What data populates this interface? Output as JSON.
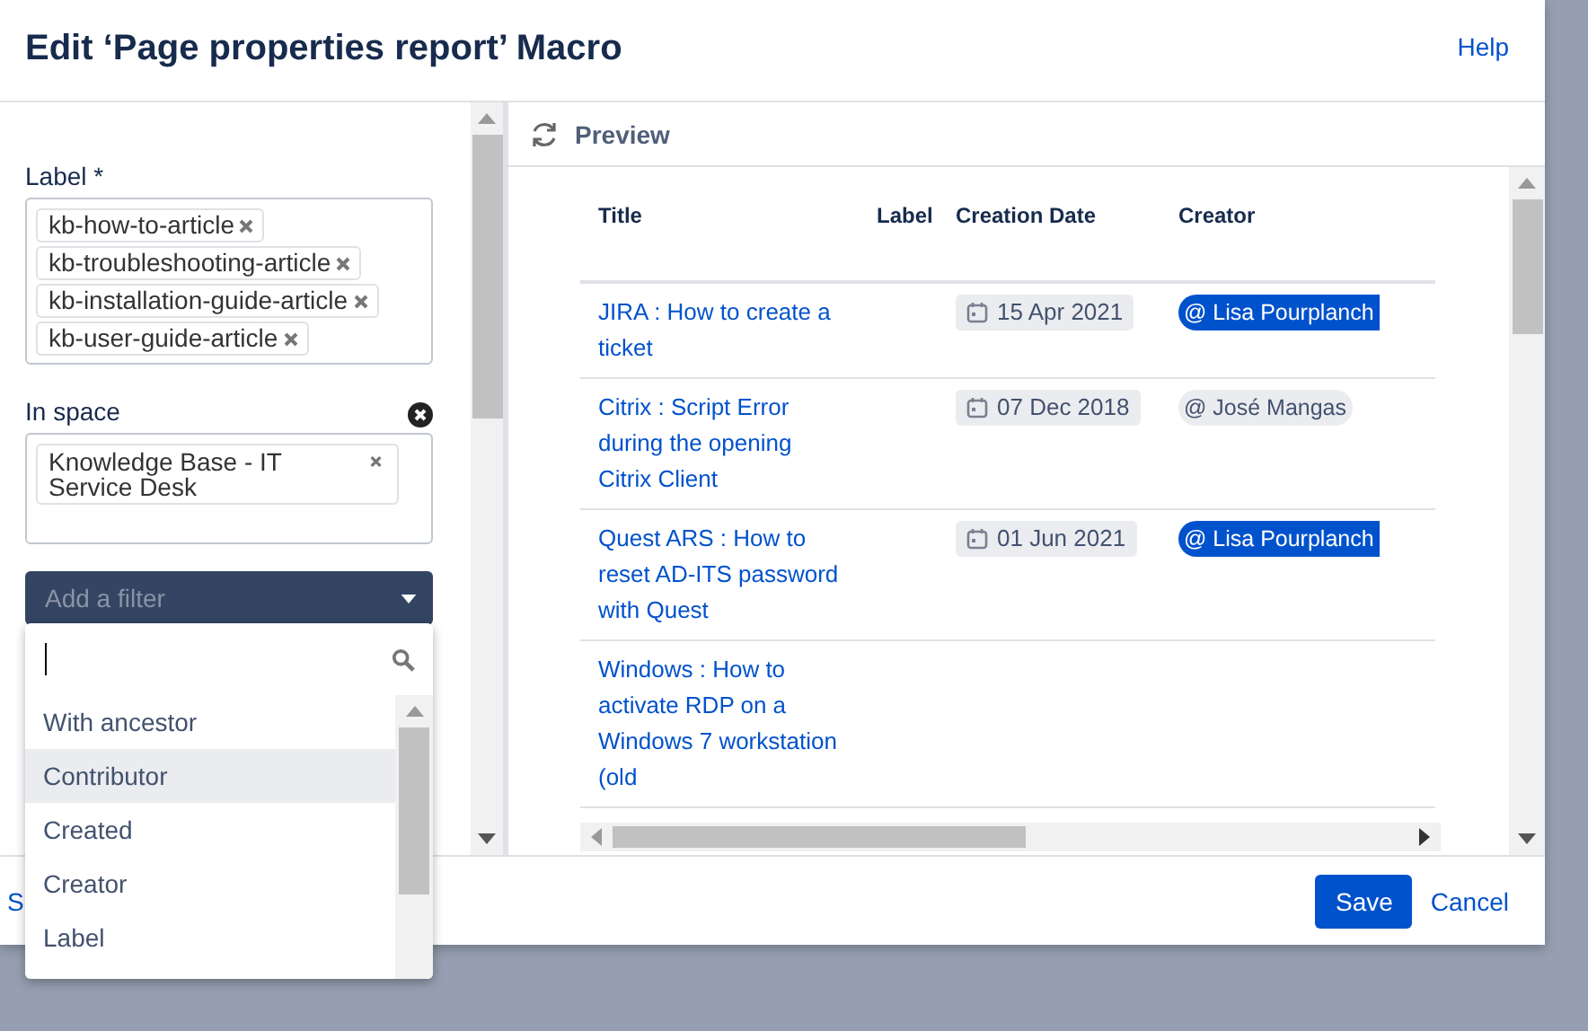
{
  "dialog": {
    "title": "Edit ‘Page properties report’ Macro",
    "help": "Help"
  },
  "form": {
    "label_field": {
      "label": "Label *",
      "tags": [
        "kb-how-to-article",
        "kb-troubleshooting-article",
        "kb-installation-guide-article",
        "kb-user-guide-article"
      ]
    },
    "space_field": {
      "label": "In space",
      "tags": [
        "Knowledge Base - IT Service Desk"
      ]
    },
    "filter": {
      "placeholder": "Add a filter",
      "expanded": true,
      "options": [
        {
          "label": "With ancestor",
          "selected": false
        },
        {
          "label": "Contributor",
          "selected": true
        },
        {
          "label": "Created",
          "selected": false
        },
        {
          "label": "Creator",
          "selected": false
        },
        {
          "label": "Label",
          "selected": false
        }
      ]
    }
  },
  "preview": {
    "title": "Preview",
    "table": {
      "columns": [
        "Title",
        "Label",
        "Creation Date",
        "Creator"
      ],
      "rows": [
        {
          "title": "JIRA : How to create a ticket",
          "date": "15 Apr 2021",
          "creator": "@ Lisa Pourplanch",
          "highlighted": true
        },
        {
          "title": "Citrix : Script Error during the opening Citrix Client",
          "date": "07 Dec 2018",
          "creator": "@ José Mangas",
          "highlighted": false
        },
        {
          "title": "Quest ARS : How to reset AD-ITS password with Quest",
          "date": "01 Jun 2021",
          "creator": "@ Lisa Pourplanch",
          "highlighted": true
        },
        {
          "title": "Windows : How to activate RDP on a Windows 7 workstation (old"
        }
      ]
    }
  },
  "footer": {
    "left_link": "S",
    "buttons": [
      {
        "label": "Save",
        "kind": "primary"
      },
      {
        "label": "Cancel",
        "kind": "link"
      }
    ]
  }
}
